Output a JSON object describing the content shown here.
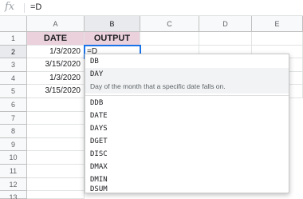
{
  "formula_bar": {
    "fx_label": "fx",
    "value": "=D"
  },
  "columns": [
    "A",
    "B",
    "C",
    "D",
    "E"
  ],
  "rows": [
    "1",
    "2",
    "3",
    "4",
    "5",
    "6",
    "7",
    "8",
    "9",
    "10",
    "11",
    "12",
    "13"
  ],
  "sheet": {
    "header_date": "DATE",
    "header_output": "OUTPUT",
    "dates": [
      "1/3/2020",
      "3/15/2020",
      "1/3/2020",
      "3/15/2020"
    ],
    "active_cell_text": "=D",
    "header_fill": "#ead1dc"
  },
  "autocomplete": {
    "items": [
      "DB",
      "DAY",
      "DDB",
      "DATE",
      "DAYS",
      "DGET",
      "DISC",
      "DMAX",
      "DMIN",
      "DSUM"
    ],
    "highlighted": "DAY",
    "description": "Day of the month that a specific date falls on."
  }
}
